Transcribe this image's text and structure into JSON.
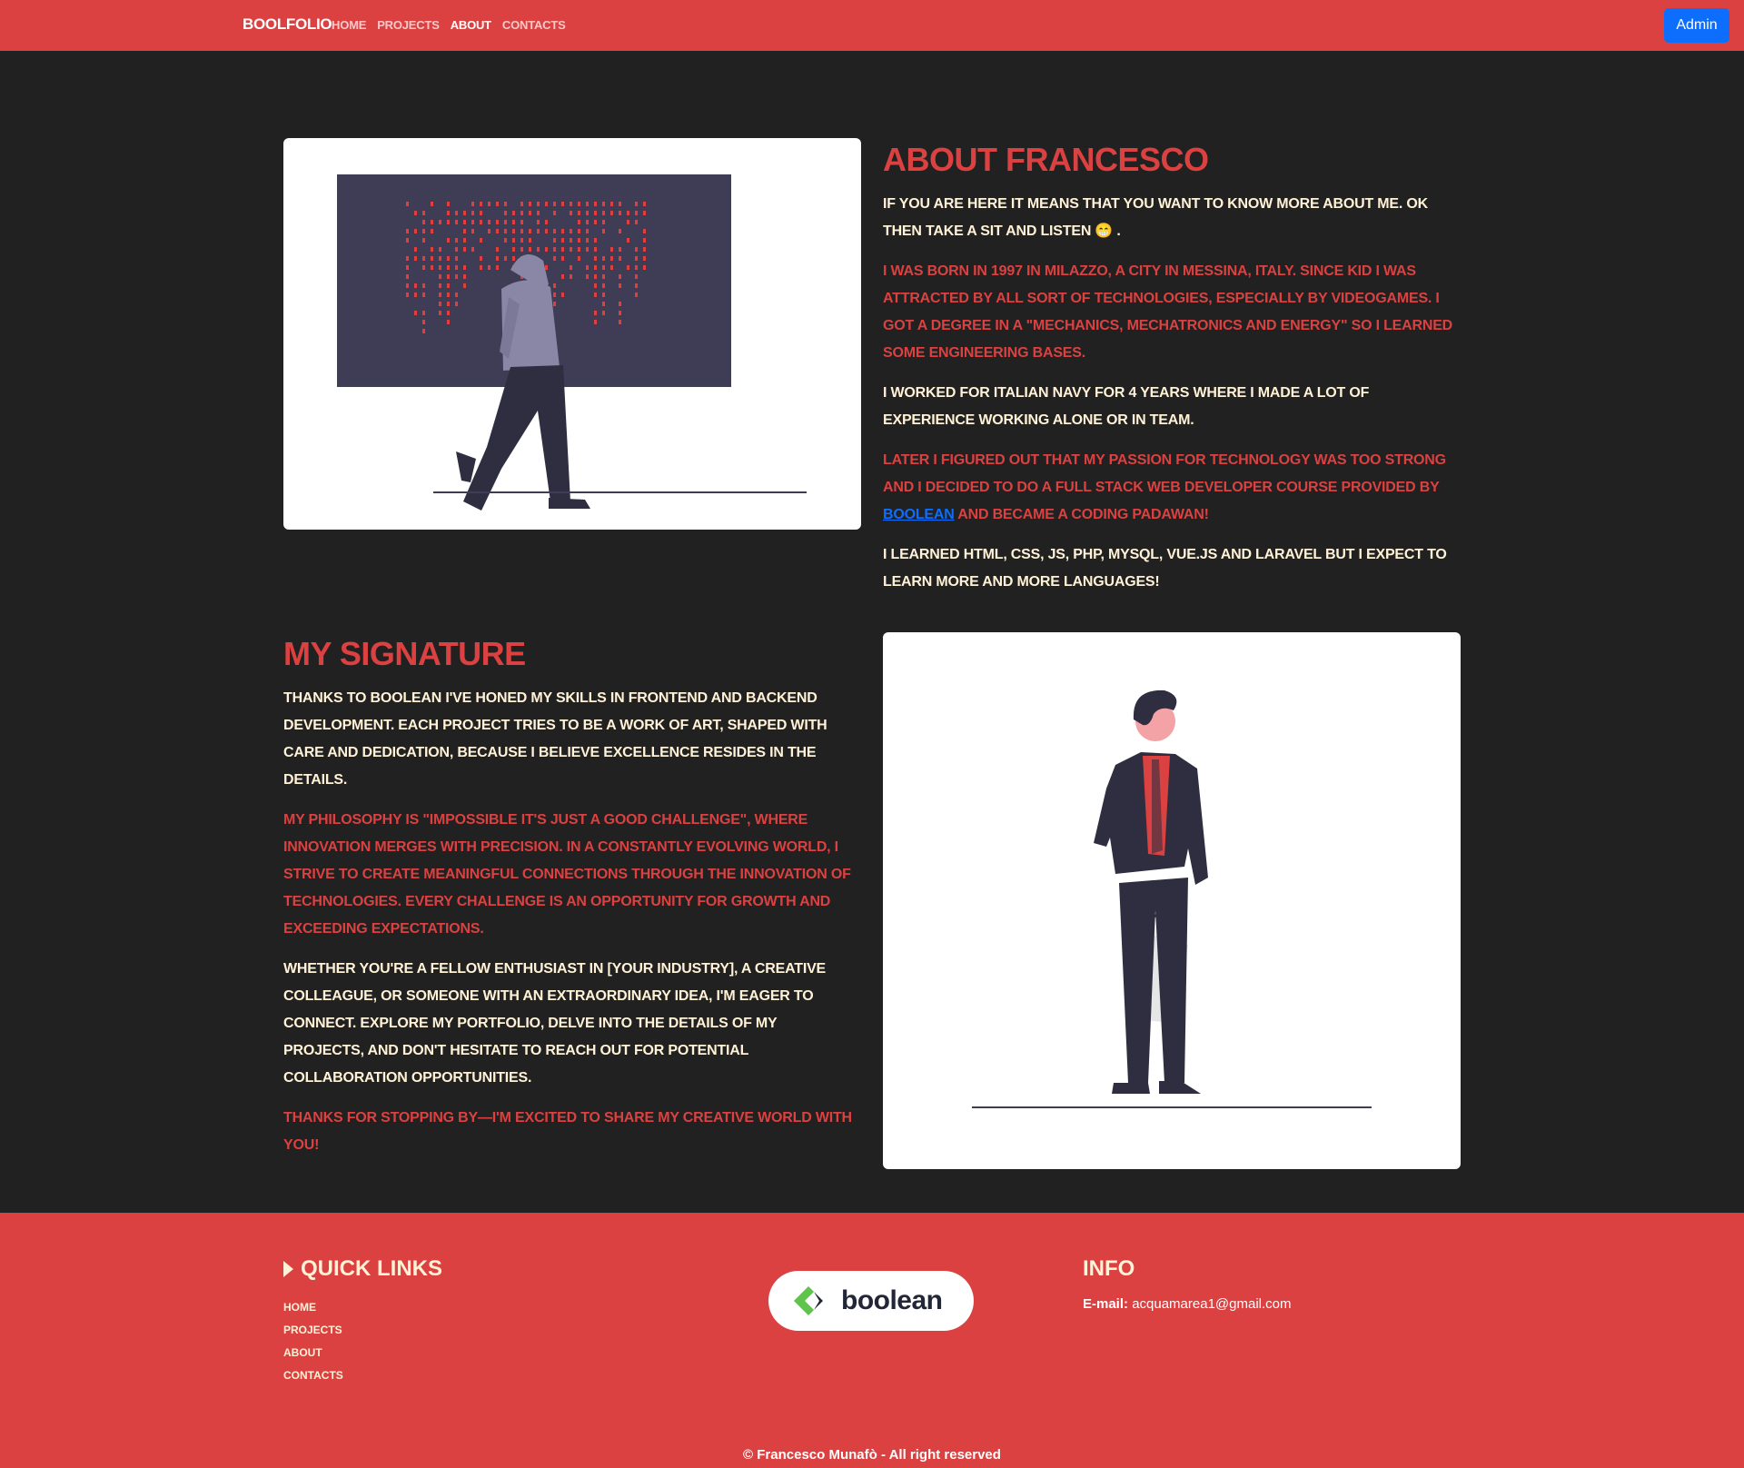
{
  "nav": {
    "brand": "BOOLFOLIO",
    "links": [
      "HOME",
      "PROJECTS",
      "ABOUT",
      "CONTACTS"
    ],
    "active": "ABOUT",
    "admin_label": "Admin"
  },
  "about": {
    "title": "ABOUT FRANCESCO",
    "intro": "IF YOU ARE HERE IT MEANS THAT YOU WANT TO KNOW MORE ABOUT ME. OK THEN TAKE A SIT AND LISTEN",
    "intro_emoji": "😁",
    "intro_end": ".",
    "born": "I WAS BORN IN 1997 IN MILAZZO, A CITY IN MESSINA, ITALY. SINCE KID I WAS ATTRACTED BY ALL SORT OF TECHNOLOGIES, ESPECIALLY BY VIDEOGAMES. I GOT A DEGREE IN A",
    "born_degree": "\"MECHANICS, MECHATRONICS AND ENERGY\"",
    "born_end": "SO I LEARNED SOME ENGINEERING BASES.",
    "navy_pre": "I WORKED FOR",
    "navy_strong": "ITALIAN NAVY",
    "navy_post": "FOR 4 YEARS WHERE I MADE A LOT OF EXPERIENCE WORKING ALONE OR IN TEAM.",
    "later_pre": "LATER I FIGURED OUT THAT MY PASSION FOR TECHNOLOGY WAS TOO STRONG AND I DECIDED TO DO A",
    "later_strong": "FULL STACK WEB DEVELOPER",
    "later_mid": "COURSE PROVIDED BY",
    "later_link": "BOOLEAN",
    "later_post": "AND BECAME A",
    "later_strong2": "CODING PADAWAN!",
    "learned_pre": "I LEARNED",
    "learned_strong": "HTML, CSS, JS, PHP, MYSQL, VUE.JS AND LARAVEL",
    "learned_post": "BUT I EXPECT TO LEARN MORE AND MORE LANGUAGES!"
  },
  "signature": {
    "title": "MY SIGNATURE",
    "p1": "THANKS TO BOOLEAN I'VE HONED MY SKILLS IN FRONTEND AND BACKEND DEVELOPMENT. EACH PROJECT TRIES TO BE A WORK OF ART, SHAPED WITH CARE AND DEDICATION, BECAUSE I BELIEVE EXCELLENCE RESIDES IN THE DETAILS.",
    "p2": "MY PHILOSOPHY IS \"IMPOSSIBLE IT'S JUST A GOOD CHALLENGE\", WHERE INNOVATION MERGES WITH PRECISION. IN A CONSTANTLY EVOLVING WORLD, I STRIVE TO CREATE MEANINGFUL CONNECTIONS THROUGH THE INNOVATION OF TECHNOLOGIES. EVERY CHALLENGE IS AN OPPORTUNITY FOR GROWTH AND EXCEEDING EXPECTATIONS.",
    "p3": "WHETHER YOU'RE A FELLOW ENTHUSIAST IN [YOUR INDUSTRY], A CREATIVE COLLEAGUE, OR SOMEONE WITH AN EXTRAORDINARY IDEA, I'M EAGER TO CONNECT. EXPLORE MY PORTFOLIO, DELVE INTO THE DETAILS OF MY PROJECTS, AND DON'T HESITATE TO REACH OUT FOR POTENTIAL COLLABORATION OPPORTUNITIES.",
    "p4": "THANKS FOR STOPPING BY—I'M EXCITED TO SHARE MY CREATIVE WORLD WITH YOU!"
  },
  "footer": {
    "quick_links_title": "QUICK LINKS",
    "quick_links": [
      "HOME",
      "PROJECTS",
      "ABOUT",
      "CONTACTS"
    ],
    "logo_text": "boolean",
    "info_title": "INFO",
    "email_label": "E-mail:",
    "email": "acquamarea1@gmail.com",
    "copyright": "© Francesco Munafò - All right reserved"
  },
  "colors": {
    "brand_red": "#dc4141",
    "background": "#212121",
    "cream": "#fff2d6",
    "admin_blue": "#0d6efd"
  }
}
